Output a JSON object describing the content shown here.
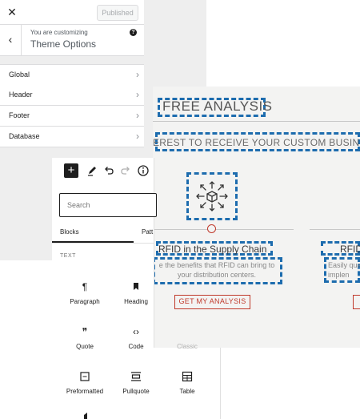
{
  "customizer": {
    "close_glyph": "✕",
    "published_label": "Published",
    "back_glyph": "‹",
    "customizing_label": "You are customizing",
    "panel_title": "Theme Options",
    "help_glyph": "?",
    "chevron_glyph": "›",
    "sections": [
      "Global",
      "Header",
      "Footer",
      "Database"
    ]
  },
  "preview": {
    "heading": "FREE ANALYSIS",
    "subtitle": "EREST TO RECEIVE YOUR CUSTOM BUSIN",
    "card1": {
      "icon": "box-with-arrows-icon",
      "title": "RFID in the Supply Chain",
      "description": "e the benefits that RFID can bring to your distribution centers.",
      "cta": "GET MY ANALYSIS"
    },
    "card2": {
      "title": "RFID",
      "description_line1": "Easily qua",
      "description_line2": "implen"
    },
    "colors": {
      "accent": "#c0392b",
      "dashed_outline": "#1d6cae"
    }
  },
  "inserter": {
    "toolbar": {
      "add": "+",
      "pen": "pen-icon",
      "undo": "undo-icon",
      "redo": "redo-icon",
      "info": "info-icon"
    },
    "search_placeholder": "Search",
    "tabs": [
      "Blocks",
      "Patt"
    ],
    "category": "TEXT",
    "blocks": [
      {
        "label": "Paragraph",
        "icon": "¶"
      },
      {
        "label": "Heading",
        "icon": "🔖"
      },
      {
        "label": "Quote",
        "icon": "❞"
      },
      {
        "label": "Code",
        "icon": "‹›"
      },
      {
        "label": "Classic",
        "icon": ""
      },
      {
        "label": "Preformatted",
        "icon": "⌨"
      },
      {
        "label": "Pullquote",
        "icon": "▭"
      },
      {
        "label": "Table",
        "icon": "▦"
      }
    ]
  }
}
